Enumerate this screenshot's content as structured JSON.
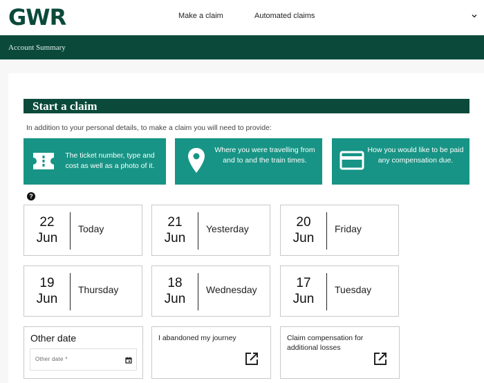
{
  "header": {
    "logo": "GWR",
    "nav": [
      "Make a claim",
      "Automated claims"
    ]
  },
  "subnav": {
    "account": "Account Summary"
  },
  "claim": {
    "title": "Start a claim",
    "intro": "In addition to your personal details, to make a claim you will need to provide:",
    "info_cards": [
      {
        "icon": "ticket-icon",
        "text": "The ticket number, type and cost as well as a photo of it."
      },
      {
        "icon": "location-pin-icon",
        "text": "Where you were travelling from and to and the train times."
      },
      {
        "icon": "credit-card-icon",
        "text": "How you would like to be paid any compensation due."
      }
    ],
    "help": "?",
    "dates": [
      {
        "num": "22",
        "month": "Jun",
        "day": "Today"
      },
      {
        "num": "21",
        "month": "Jun",
        "day": "Yesterday"
      },
      {
        "num": "20",
        "month": "Jun",
        "day": "Friday"
      },
      {
        "num": "19",
        "month": "Jun",
        "day": "Thursday"
      },
      {
        "num": "18",
        "month": "Jun",
        "day": "Wednesday"
      },
      {
        "num": "17",
        "month": "Jun",
        "day": "Tuesday"
      }
    ],
    "other_date": {
      "title": "Other date",
      "placeholder": "Other date *"
    },
    "links": [
      {
        "label": "I abandoned my journey"
      },
      {
        "label": "Claim compensation for additional losses"
      }
    ]
  },
  "colors": {
    "brand_dark": "#0b4a3b",
    "brand_teal": "#179485"
  }
}
